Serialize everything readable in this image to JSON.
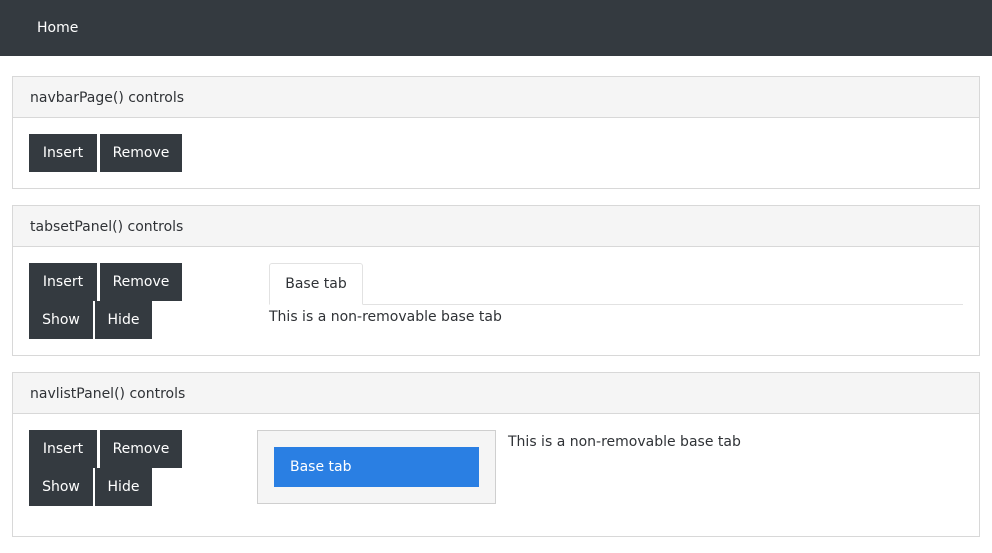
{
  "navbar": {
    "home_label": "Home"
  },
  "panels": [
    {
      "title": "navbarPage() controls",
      "buttons": {
        "insert": "Insert",
        "remove": "Remove"
      }
    },
    {
      "title": "tabsetPanel() controls",
      "buttons": {
        "insert": "Insert",
        "remove": "Remove",
        "show": "Show",
        "hide": "Hide"
      },
      "tabs": [
        {
          "label": "Base tab",
          "active": true
        }
      ],
      "content": "This is a non-removable base tab"
    },
    {
      "title": "navlistPanel() controls",
      "buttons": {
        "insert": "Insert",
        "remove": "Remove",
        "show": "Show",
        "hide": "Hide"
      },
      "navlist": [
        {
          "label": "Base tab",
          "active": true
        }
      ],
      "content": "This is a non-removable base tab"
    }
  ],
  "colors": {
    "navbar_bg": "#343a40",
    "button_bg": "#343a40",
    "navlist_active": "#2a7fe3"
  }
}
